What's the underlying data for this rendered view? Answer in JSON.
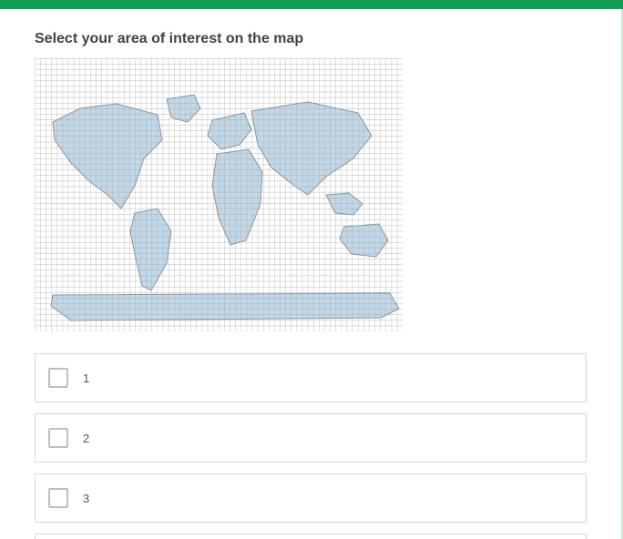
{
  "prompt": "Select your area of interest on the map",
  "colors": {
    "accent": "#0f9d58",
    "land": "#bcd4e6",
    "grid": "#9f9f9f",
    "coast": "#7f8a94"
  },
  "map": {
    "grid_cols": 66,
    "grid_rows": 49
  },
  "options": [
    {
      "label": "1"
    },
    {
      "label": "2"
    },
    {
      "label": "3"
    }
  ]
}
